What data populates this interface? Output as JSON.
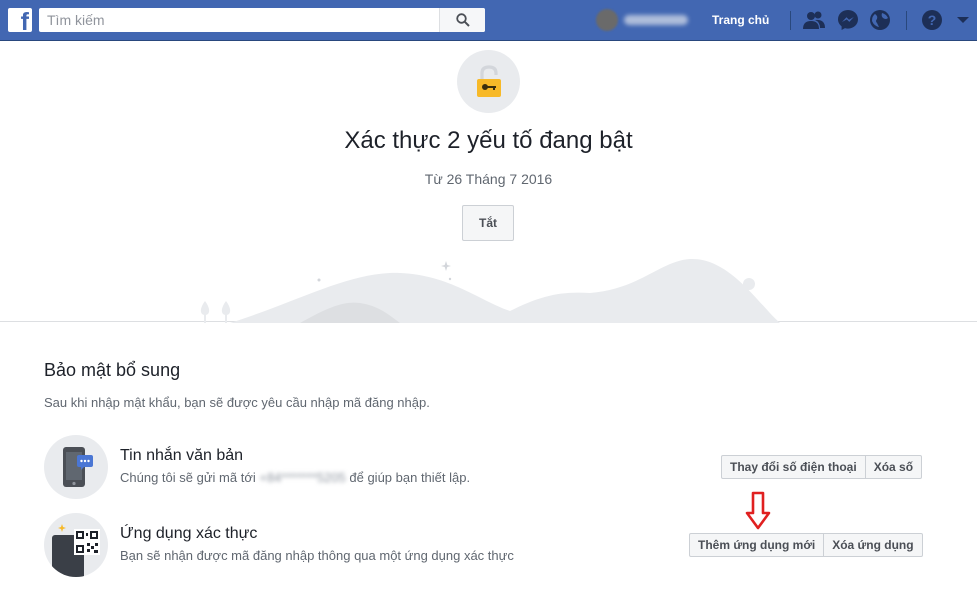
{
  "topbar": {
    "logo_letter": "f",
    "search_placeholder": "Tìm kiếm",
    "home_label": "Trang chủ",
    "icons": [
      "search-icon",
      "friends-icon",
      "messenger-icon",
      "globe-icon",
      "help-icon",
      "dropdown-caret-icon"
    ]
  },
  "hero": {
    "title": "Xác thực 2 yếu tố đang bật",
    "date": "Từ 26 Tháng 7 2016",
    "off_button": "Tắt"
  },
  "security": {
    "title": "Bảo mật bổ sung",
    "description": "Sau khi nhập mật khẩu, bạn sẽ được yêu cầu nhập mã đăng nhập.",
    "methods": [
      {
        "title": "Tin nhắn văn bản",
        "desc_before": "Chúng tôi sẽ gửi mã tới",
        "desc_masked": "+84*******5205",
        "desc_after": "để giúp bạn thiết lập.",
        "buttons": [
          "Thay đổi số điện thoại",
          "Xóa số"
        ]
      },
      {
        "title": "Ứng dụng xác thực",
        "desc": "Bạn sẽ nhận được mã đăng nhập thông qua một ứng dụng xác thực",
        "buttons": [
          "Thêm ứng dụng mới",
          "Xóa ứng dụng"
        ]
      }
    ]
  },
  "colors": {
    "facebook_blue": "#4267b2",
    "lock_yellow": "#f7b928",
    "annotation_red": "#e02020"
  }
}
